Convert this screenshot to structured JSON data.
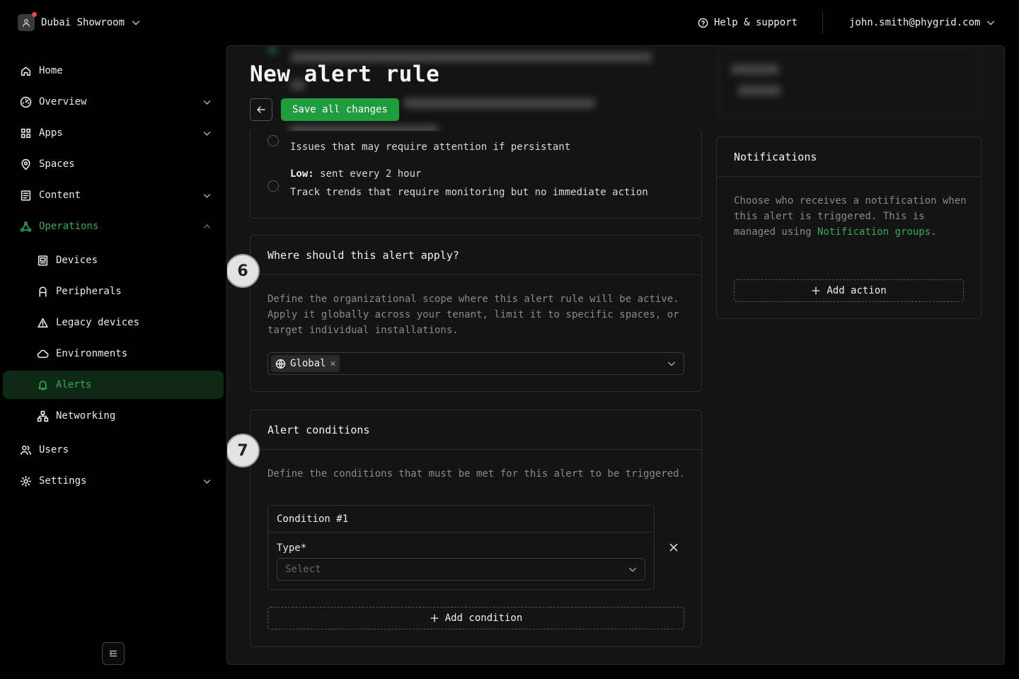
{
  "workspace": {
    "name": "Dubai Showroom"
  },
  "topbar": {
    "help_label": "Help & support",
    "account_email": "john.smith@phygrid.com"
  },
  "sidebar": {
    "items": [
      {
        "label": "Home",
        "icon": "home-icon"
      },
      {
        "label": "Overview",
        "icon": "gauge-icon"
      },
      {
        "label": "Apps",
        "icon": "apps-grid-icon"
      },
      {
        "label": "Spaces",
        "icon": "map-pin-icon"
      },
      {
        "label": "Content",
        "icon": "content-icon"
      },
      {
        "label": "Operations",
        "icon": "operations-icon"
      },
      {
        "label": "Devices",
        "icon": "device-icon"
      },
      {
        "label": "Peripherals",
        "icon": "peripheral-icon"
      },
      {
        "label": "Legacy devices",
        "icon": "warning-icon"
      },
      {
        "label": "Environments",
        "icon": "cloud-icon"
      },
      {
        "label": "Alerts",
        "icon": "bell-icon"
      },
      {
        "label": "Networking",
        "icon": "network-icon"
      },
      {
        "label": "Users",
        "icon": "users-icon"
      },
      {
        "label": "Settings",
        "icon": "gear-icon"
      }
    ],
    "active_item": "Alerts"
  },
  "page": {
    "title": "New alert rule",
    "save_label": "Save all changes"
  },
  "priority": {
    "medium_desc": "Issues that may require attention if persistant",
    "low_label": "Low:",
    "low_freq": "sent every 2 hour",
    "low_desc": "Track trends that require monitoring but no immediate action"
  },
  "scope": {
    "step": "6",
    "title": "Where should this alert apply?",
    "description": "Define the organizational scope where this alert rule will be active. Apply it globally across your tenant, limit it to specific spaces, or target individual installations.",
    "selected_chip": "Global"
  },
  "conditions": {
    "step": "7",
    "title": "Alert conditions",
    "description": "Define the conditions that must be met for this alert to be triggered.",
    "condition_title": "Condition #1",
    "type_label": "Type",
    "required_mark": "*",
    "type_placeholder": "Select",
    "add_label": "Add condition"
  },
  "notifications": {
    "title": "Notifications",
    "desc_before": "Choose who receives a notification when this alert is triggered. This is managed using ",
    "link_text": "Notification groups",
    "desc_after": ".",
    "add_label": "Add action"
  },
  "colors": {
    "accent": "#1f9d3e",
    "link": "#3aa85a",
    "active_bg": "#0e2a17"
  }
}
